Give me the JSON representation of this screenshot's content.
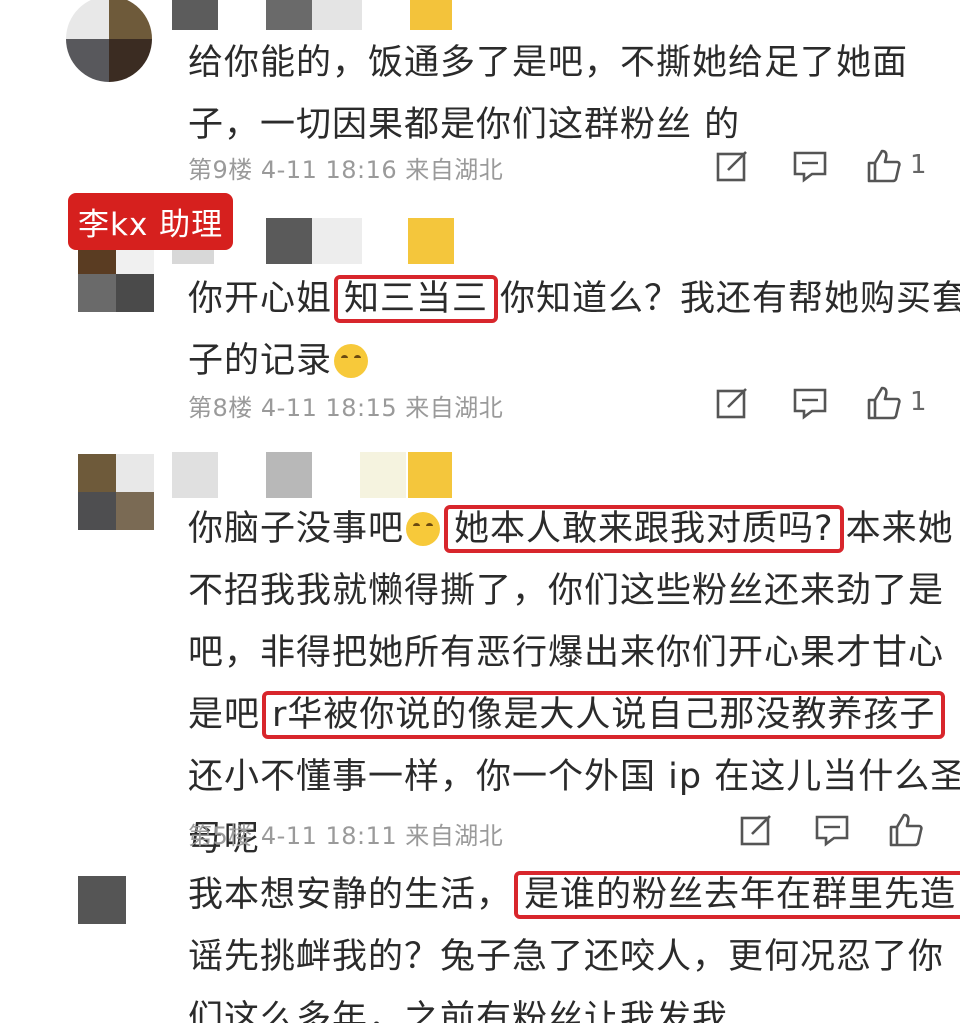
{
  "comments": [
    {
      "lines": [
        "给你能的，饭通多了是吧，不撕她给足了她面",
        "子，一切因果都是你们这群粉丝 的"
      ],
      "meta": "第9楼 4-11 18:16 来自湖北",
      "likes": "1"
    },
    {
      "tag": "李kx 助理",
      "line1_pre": "你开心姐",
      "line1_hl": "知三当三",
      "line1_post": "你知道么？我还有帮她购买套",
      "line2": "子的记录",
      "meta": "第8楼 4-11 18:15 来自湖北",
      "likes": "1"
    },
    {
      "line1_pre": "你脑子没事吧",
      "line1_hl": "她本人敢来跟我对质吗?",
      "line1_post": "本来她",
      "line2": "不招我我就懒得撕了，你们这些粉丝还来劲了是",
      "line3": "吧，非得把她所有恶行爆出来你们开心果才甘心",
      "line4_pre": "是吧",
      "line4_hl": "r华被你说的像是大人说自己那没教养孩子",
      "line5": "还小不懂事一样，你一个外国 ip 在这儿当什么圣",
      "line6": "母呢",
      "meta": "第5楼 4-11 18:11 来自湖北"
    },
    {
      "line1_pre": "我本想安静的生活，",
      "line1_hl": "是谁的粉丝去年在群里先造",
      "line2": "谣先挑衅我的？兔子急了还咬人，更何况忍了你",
      "line3": "们这么多年，之前有粉丝让我发我"
    }
  ],
  "icons": {
    "reply": "edit-square-icon",
    "comment": "comment-bubble-icon",
    "like": "thumbs-up-icon"
  },
  "colors": {
    "highlight": "#d8262c",
    "tag_bg": "#d6201e",
    "meta": "#9a9a9a"
  }
}
